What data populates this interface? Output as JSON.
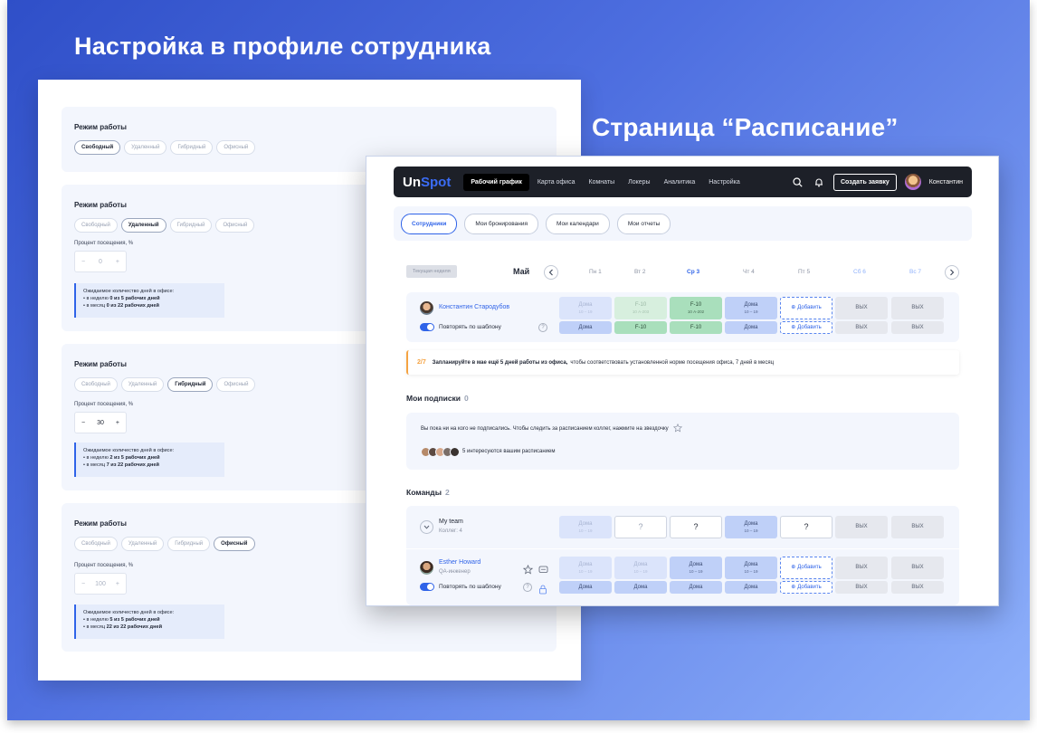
{
  "headings": {
    "profile": "Настройка в профиле сотрудника",
    "schedule": "Страница “Расписание”"
  },
  "profile": {
    "cards": [
      {
        "title": "Режим работы",
        "chips": [
          "Свободный",
          "Удаленный",
          "Гибридный",
          "Офисный"
        ],
        "active": 0
      },
      {
        "title": "Режим работы",
        "chips": [
          "Свободный",
          "Удаленный",
          "Гибридный",
          "Офисный"
        ],
        "active": 1,
        "pct_label": "Процент посещения, %",
        "minus": "−",
        "value": "0",
        "plus": "+",
        "info_title": "Ожидаемое количество дней в офисе:",
        "week_prefix": "в неделю",
        "week_value": "0 из 5 рабочих дней",
        "month_prefix": "в месяц",
        "month_value": "0 из 22 рабочих дней"
      },
      {
        "title": "Режим работы",
        "chips": [
          "Свободный",
          "Удаленный",
          "Гибридный",
          "Офисный"
        ],
        "active": 2,
        "pct_label": "Процент посещения, %",
        "minus": "−",
        "value": "30",
        "plus": "+",
        "info_title": "Ожидаемое количество дней в офисе:",
        "week_prefix": "в неделю",
        "week_value": "2 из 5 рабочих дней",
        "month_prefix": "в месяц",
        "month_value": "7 из 22 рабочих дней"
      },
      {
        "title": "Режим работы",
        "chips": [
          "Свободный",
          "Удаленный",
          "Гибридный",
          "Офисный"
        ],
        "active": 3,
        "pct_label": "Процент посещения, %",
        "minus": "−",
        "value": "100",
        "plus": "+",
        "info_title": "Ожидаемое количество дней в офисе:",
        "week_prefix": "в неделю",
        "week_value": "5 из 5 рабочих дней",
        "month_prefix": "в месяц",
        "month_value": "22 из 22 рабочих дней"
      }
    ]
  },
  "topbar": {
    "logo_a": "Un",
    "logo_b": "Spot",
    "nav": [
      "Рабочий график",
      "Карта офиса",
      "Комнаты",
      "Локеры",
      "Аналитика",
      "Настройка"
    ],
    "create": "Создать заявку",
    "user": "Константин"
  },
  "subtabs": [
    "Сотрудники",
    "Мои бронирования",
    "Мои календари",
    "Мои отчеты"
  ],
  "week": {
    "current": "Текущая неделя",
    "month": "Май",
    "days": [
      "Пн 1",
      "Вт 2",
      "Ср 3",
      "Чт 4",
      "Пт 5",
      "Сб 6",
      "Вс 7"
    ]
  },
  "me": {
    "name": "Константин Стародубов",
    "repeat": "Повторять по шаблону",
    "help": "?",
    "top": [
      {
        "label": "Дома",
        "sub": "10 – 19"
      },
      {
        "label": "F-10",
        "sub": "10 А-203"
      },
      {
        "label": "F-10",
        "sub": "10 А-202"
      },
      {
        "label": "Дома",
        "sub": "10 – 19"
      },
      {
        "label": "Добавить",
        "sub": ""
      },
      {
        "label": "ВЫХ",
        "sub": ""
      },
      {
        "label": "ВЫХ",
        "sub": ""
      }
    ],
    "bottom": [
      "Дома",
      "F-10",
      "F-10",
      "Дома",
      "Добавить",
      "ВЫХ",
      "ВЫХ"
    ]
  },
  "alert": {
    "fraction": "2/7",
    "bold": "Запланируйте в мае ещё 5 дней работы из офиса,",
    "rest": "чтобы соответствовать установленной норме посещения офиса, 7 дней в месяц"
  },
  "subscriptions": {
    "title": "Мои подписки",
    "count": "0",
    "empty_text": "Вы пока ни на кого не подписались. Чтобы следить за расписанием коллег, нажмите на звездочку",
    "interested": "5 интересуются вашим расписанием"
  },
  "teams": {
    "title": "Команды",
    "count": "2",
    "team": {
      "name": "My team",
      "members": "Коллег: 4",
      "cells": [
        {
          "label": "Дома",
          "sub": "10 – 19"
        },
        {
          "label": "?",
          "sub": ""
        },
        {
          "label": "?",
          "sub": ""
        },
        {
          "label": "Дома",
          "sub": "10 – 19"
        },
        {
          "label": "?",
          "sub": ""
        },
        {
          "label": "ВЫХ",
          "sub": ""
        },
        {
          "label": "ВЫХ",
          "sub": ""
        }
      ]
    },
    "member": {
      "name": "Esther Howard",
      "role": "QA-инженер",
      "repeat": "Повторять по шаблону",
      "help": "?",
      "top": [
        {
          "label": "Дома",
          "sub": "10 – 19"
        },
        {
          "label": "Дома",
          "sub": "10 – 19"
        },
        {
          "label": "Дома",
          "sub": "10 – 19"
        },
        {
          "label": "Дома",
          "sub": "10 – 19"
        },
        {
          "label": "Добавить",
          "sub": ""
        },
        {
          "label": "ВЫХ",
          "sub": ""
        },
        {
          "label": "ВЫХ",
          "sub": ""
        }
      ],
      "bottom": [
        "Дома",
        "Дома",
        "Дома",
        "Дома",
        "Добавить",
        "ВЫХ",
        "ВЫХ"
      ]
    }
  },
  "colors": {
    "accent": "#2f63e8",
    "topbar": "#1d2028",
    "alert": "#f5a342",
    "home": "#bfd0f8",
    "office": "#a9dfbc",
    "off": "#e6e8ee"
  }
}
